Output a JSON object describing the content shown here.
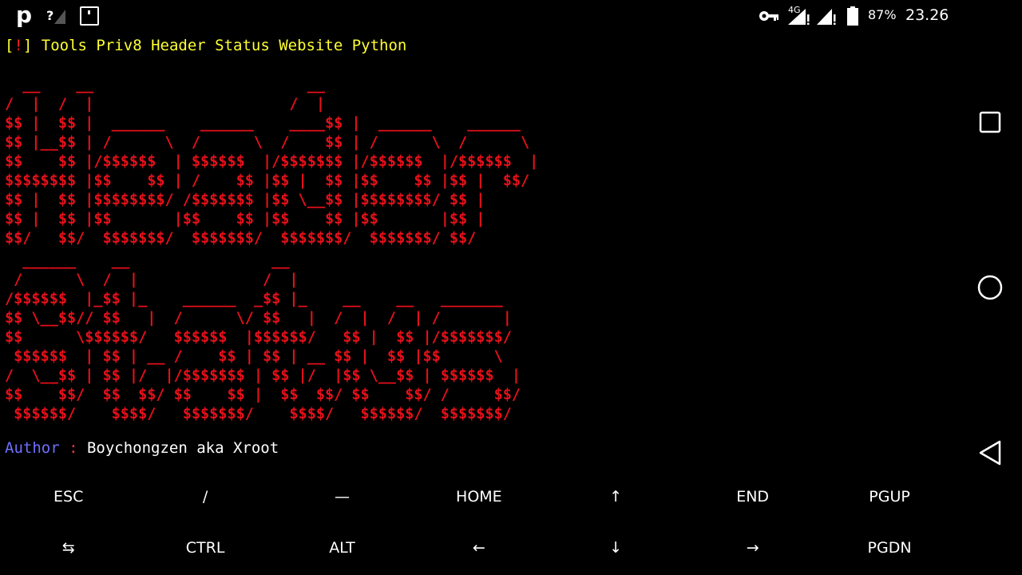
{
  "status_bar": {
    "app_icon": "p",
    "network_label": "4G",
    "battery_percent": "87%",
    "time": "23.26"
  },
  "terminal": {
    "title": {
      "open_bracket": "[",
      "bang": "!",
      "close_bracket": "]",
      "text": " Tools Priv8 Header Status Website Python"
    },
    "ascii_art_header": "  __    __                        __\n/  |  /  |                      /  |\n$$ |  $$ |  ______    ______    ____$$ |  ______    ______\n$$ |__$$ | /      \\  /      \\  /    $$ | /      \\  /      \\\n$$    $$ |/$$$$$$  | $$$$$$  |/$$$$$$$ |/$$$$$$  |/$$$$$$  |\n$$$$$$$$ |$$    $$ | /    $$ |$$ |  $$ |$$    $$ |$$ |  $$/\n$$ |  $$ |$$$$$$$$/ /$$$$$$$ |$$ \\__$$ |$$$$$$$$/ $$ |\n$$ |  $$ |$$       |$$    $$ |$$    $$ |$$       |$$ |\n$$/   $$/  $$$$$$$/  $$$$$$$/  $$$$$$$/  $$$$$$$/ $$/",
    "ascii_art_status": "  ______    __                __\n /      \\  /  |              /  |\n/$$$$$$  |_$$ |_    ______  _$$ |_    __    __   _______\n$$ \\__$$// $$   |  /      \\/ $$   |  /  |  /  | /       |\n$$      \\$$$$$$/   $$$$$$  |$$$$$$/   $$ |  $$ |/$$$$$$$/\n $$$$$$  | $$ | __ /    $$ | $$ | __ $$ |  $$ |$$      \\\n/  \\__$$ | $$ |/  |/$$$$$$$ | $$ |/  |$$ \\__$$ | $$$$$$  |\n$$    $$/  $$  $$/ $$    $$ |  $$  $$/ $$    $$/ /     $$/\n $$$$$$/    $$$$/   $$$$$$$/    $$$$/   $$$$$$/  $$$$$$$/",
    "author_label": "Author",
    "author_sep": " : ",
    "author_value": "Boychongzen aka Xroot"
  },
  "extra_keys": {
    "row1": [
      "ESC",
      "/",
      "—",
      "HOME",
      "↑",
      "END",
      "PGUP"
    ],
    "row2": [
      "⇆",
      "CTRL",
      "ALT",
      "←",
      "↓",
      "→",
      "PGDN"
    ]
  },
  "nav_bar": {
    "recents_icon": "square-icon",
    "home_icon": "circle-icon",
    "back_icon": "triangle-back-icon"
  },
  "colors": {
    "title": "#ffff33",
    "ascii_art": "#e8101a",
    "author_label": "#6f6fff",
    "background": "#000000"
  }
}
